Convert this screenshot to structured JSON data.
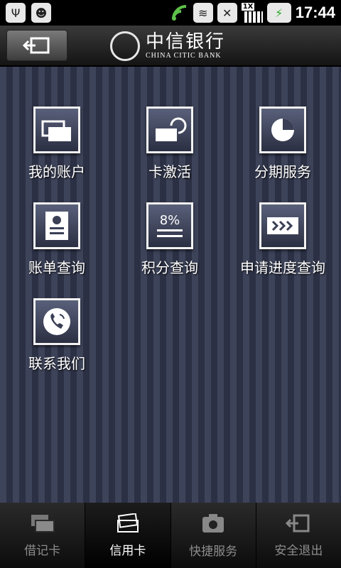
{
  "status": {
    "time": "17:44",
    "signal_badge": "1X"
  },
  "header": {
    "title_cn": "中信银行",
    "title_en": "CHINA CITIC BANK"
  },
  "menu": [
    {
      "label": "我的账户",
      "icon": "card-stack-icon"
    },
    {
      "label": "卡激活",
      "icon": "card-refresh-icon"
    },
    {
      "label": "分期服务",
      "icon": "pie-chart-icon"
    },
    {
      "label": "账单查询",
      "icon": "bill-icon"
    },
    {
      "label": "积分查询",
      "icon": "percent-icon"
    },
    {
      "label": "申请进度查询",
      "icon": "progress-arrows-icon"
    },
    {
      "label": "联系我们",
      "icon": "phone-icon"
    }
  ],
  "tabs": [
    {
      "label": "借记卡",
      "icon": "debit-card-icon"
    },
    {
      "label": "信用卡",
      "icon": "credit-card-icon",
      "active": true
    },
    {
      "label": "快捷服务",
      "icon": "camera-icon"
    },
    {
      "label": "安全退出",
      "icon": "exit-icon"
    }
  ]
}
